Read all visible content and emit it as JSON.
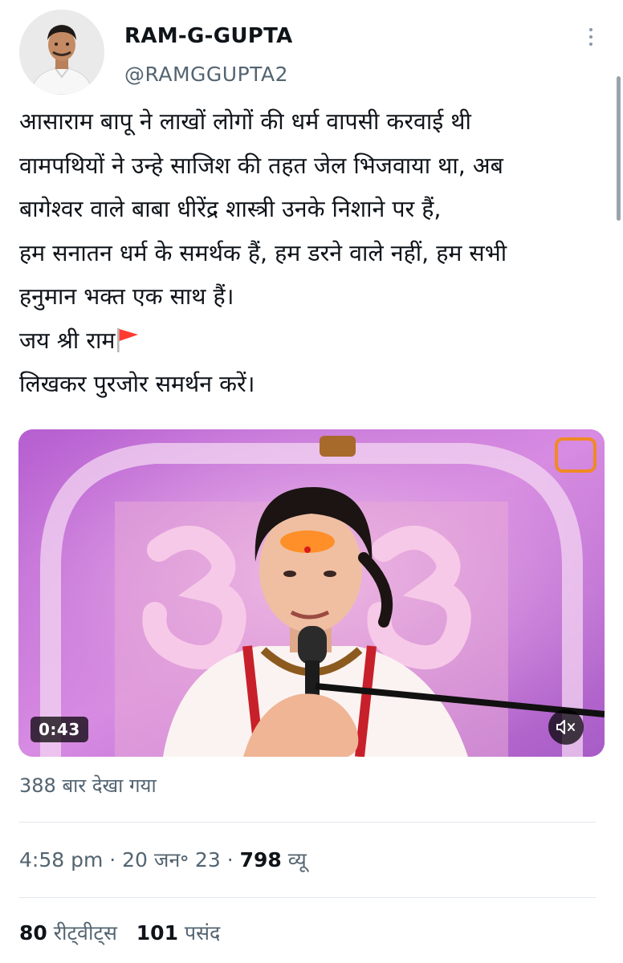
{
  "author": {
    "name": "RAM-G-GUPTA",
    "handle": "@RAMGGUPTA2"
  },
  "more_icon": "more-vertical-icon",
  "tweet": {
    "lines": [
      "आसाराम बापू ने लाखों लोगों की धर्म वापसी करवाई थी",
      "वामपथियों ने उन्हे साजिश की तहत जेल भिजवाया था, अब",
      "बागेश्वर वाले बाबा धीरेंद्र शास्त्री उनके निशाने पर हैं,",
      "हम सनातन धर्म के समर्थक हैं, हम डरने वाले नहीं, हम सभी",
      "हनुमान भक्त एक साथ हैं।",
      "जय श्री राम",
      "लिखकर पुरजोर समर्थन करें।"
    ],
    "flag_icon": "saffron-flag-icon"
  },
  "video": {
    "duration": "0:43",
    "mute_icon": "speaker-muted-icon",
    "views": "388 बार देखा गया"
  },
  "meta": {
    "time": "4:58 pm",
    "sep": " · ",
    "date": "20 जन॰ 23",
    "views_count": "798",
    "views_label": "व्यू"
  },
  "stats": {
    "retweets": "80",
    "retweets_label": "रीट्वीट्स",
    "likes": "101",
    "likes_label": "पसंद"
  },
  "colors": {
    "text": "#0f1419",
    "secondary": "#536471",
    "divider": "#e1e5e9",
    "flag": "#ff3b30"
  }
}
